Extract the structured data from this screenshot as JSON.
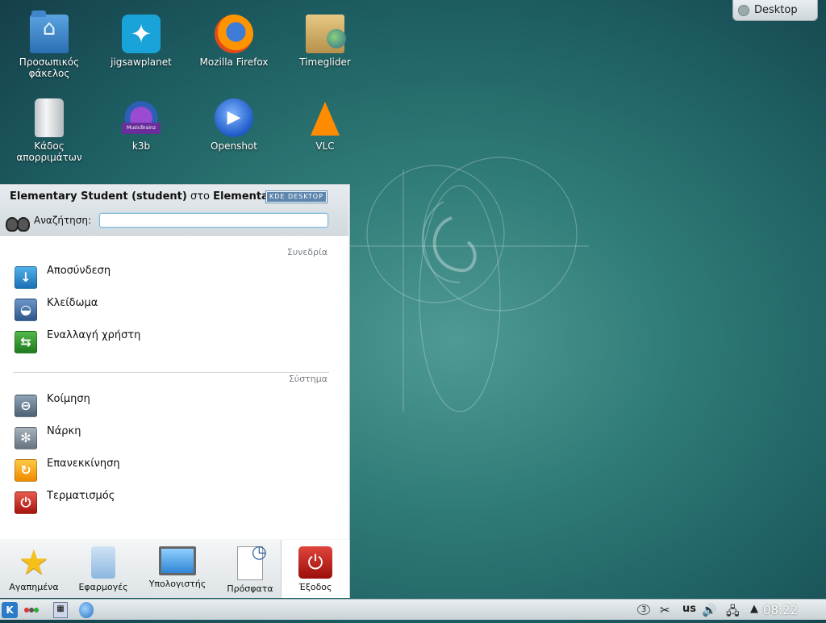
{
  "desktop": {
    "toolbox_label": "Desktop",
    "icons": [
      {
        "name": "Προσωπικός φάκελος",
        "icon": "home-folder-icon"
      },
      {
        "name": "jigsawplanet",
        "icon": "puzzle-icon"
      },
      {
        "name": "Mozilla Firefox",
        "icon": "firefox-icon"
      },
      {
        "name": "Timeglider",
        "icon": "timeglider-icon"
      },
      {
        "name": "Κάδος απορριμάτων",
        "icon": "trash-icon"
      },
      {
        "name": "k3b",
        "icon": "k3b-icon"
      },
      {
        "name": "Openshot",
        "icon": "openshot-icon"
      },
      {
        "name": "VLC",
        "icon": "vlc-icon"
      }
    ]
  },
  "menu": {
    "user_name": "Elementary Student (student)",
    "user_connector": "στο",
    "host": "Elementar",
    "badge": "KDE DESKTOP",
    "search_label": "Αναζήτηση:",
    "search_value": "",
    "sections": [
      {
        "title": "Συνεδρία",
        "items": [
          {
            "label": "Αποσύνδεση",
            "icon": "logout-icon"
          },
          {
            "label": "Κλείδωμα",
            "icon": "lock-icon"
          },
          {
            "label": "Εναλλαγή χρήστη",
            "icon": "switch-user-icon"
          }
        ]
      },
      {
        "title": "Σύστημα",
        "items": [
          {
            "label": "Κοίμηση",
            "icon": "sleep-icon"
          },
          {
            "label": "Νάρκη",
            "icon": "hibernate-icon"
          },
          {
            "label": "Επανεκκίνηση",
            "icon": "restart-icon"
          },
          {
            "label": "Τερματισμός",
            "icon": "shutdown-icon"
          }
        ]
      }
    ],
    "tabs": [
      {
        "label": "Αγαπημένα",
        "icon": "star-icon"
      },
      {
        "label": "Εφαρμογές",
        "icon": "applications-icon"
      },
      {
        "label": "Υπολογιστής",
        "icon": "computer-icon"
      },
      {
        "label": "Πρόσφατα",
        "icon": "recent-icon"
      },
      {
        "label": "Έξοδος",
        "icon": "exit-icon"
      }
    ],
    "active_tab": "Έξοδος"
  },
  "taskbar": {
    "keyboard_layout": "us",
    "clipboard_count": "3",
    "clock": "08:22"
  },
  "colors": {
    "desktop_bg": "#2f7b77",
    "taskbar_bg": "#dde3e6",
    "menu_bg": "#ffffff",
    "accent": "#2b7cc8"
  }
}
